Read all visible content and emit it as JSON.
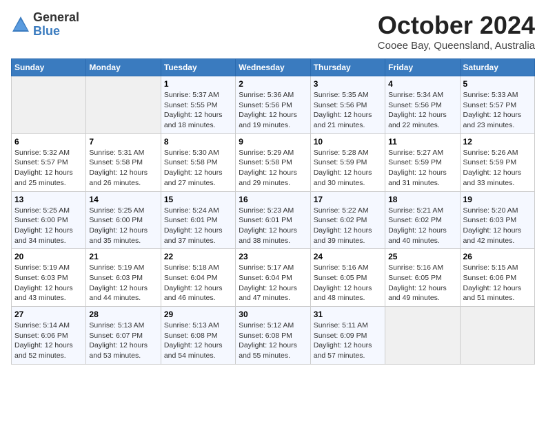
{
  "header": {
    "logo_line1": "General",
    "logo_line2": "Blue",
    "month": "October 2024",
    "location": "Cooee Bay, Queensland, Australia"
  },
  "weekdays": [
    "Sunday",
    "Monday",
    "Tuesday",
    "Wednesday",
    "Thursday",
    "Friday",
    "Saturday"
  ],
  "weeks": [
    [
      {
        "day": "",
        "sunrise": "",
        "sunset": "",
        "daylight": ""
      },
      {
        "day": "",
        "sunrise": "",
        "sunset": "",
        "daylight": ""
      },
      {
        "day": "1",
        "sunrise": "Sunrise: 5:37 AM",
        "sunset": "Sunset: 5:55 PM",
        "daylight": "Daylight: 12 hours and 18 minutes."
      },
      {
        "day": "2",
        "sunrise": "Sunrise: 5:36 AM",
        "sunset": "Sunset: 5:56 PM",
        "daylight": "Daylight: 12 hours and 19 minutes."
      },
      {
        "day": "3",
        "sunrise": "Sunrise: 5:35 AM",
        "sunset": "Sunset: 5:56 PM",
        "daylight": "Daylight: 12 hours and 21 minutes."
      },
      {
        "day": "4",
        "sunrise": "Sunrise: 5:34 AM",
        "sunset": "Sunset: 5:56 PM",
        "daylight": "Daylight: 12 hours and 22 minutes."
      },
      {
        "day": "5",
        "sunrise": "Sunrise: 5:33 AM",
        "sunset": "Sunset: 5:57 PM",
        "daylight": "Daylight: 12 hours and 23 minutes."
      }
    ],
    [
      {
        "day": "6",
        "sunrise": "Sunrise: 5:32 AM",
        "sunset": "Sunset: 5:57 PM",
        "daylight": "Daylight: 12 hours and 25 minutes."
      },
      {
        "day": "7",
        "sunrise": "Sunrise: 5:31 AM",
        "sunset": "Sunset: 5:58 PM",
        "daylight": "Daylight: 12 hours and 26 minutes."
      },
      {
        "day": "8",
        "sunrise": "Sunrise: 5:30 AM",
        "sunset": "Sunset: 5:58 PM",
        "daylight": "Daylight: 12 hours and 27 minutes."
      },
      {
        "day": "9",
        "sunrise": "Sunrise: 5:29 AM",
        "sunset": "Sunset: 5:58 PM",
        "daylight": "Daylight: 12 hours and 29 minutes."
      },
      {
        "day": "10",
        "sunrise": "Sunrise: 5:28 AM",
        "sunset": "Sunset: 5:59 PM",
        "daylight": "Daylight: 12 hours and 30 minutes."
      },
      {
        "day": "11",
        "sunrise": "Sunrise: 5:27 AM",
        "sunset": "Sunset: 5:59 PM",
        "daylight": "Daylight: 12 hours and 31 minutes."
      },
      {
        "day": "12",
        "sunrise": "Sunrise: 5:26 AM",
        "sunset": "Sunset: 5:59 PM",
        "daylight": "Daylight: 12 hours and 33 minutes."
      }
    ],
    [
      {
        "day": "13",
        "sunrise": "Sunrise: 5:25 AM",
        "sunset": "Sunset: 6:00 PM",
        "daylight": "Daylight: 12 hours and 34 minutes."
      },
      {
        "day": "14",
        "sunrise": "Sunrise: 5:25 AM",
        "sunset": "Sunset: 6:00 PM",
        "daylight": "Daylight: 12 hours and 35 minutes."
      },
      {
        "day": "15",
        "sunrise": "Sunrise: 5:24 AM",
        "sunset": "Sunset: 6:01 PM",
        "daylight": "Daylight: 12 hours and 37 minutes."
      },
      {
        "day": "16",
        "sunrise": "Sunrise: 5:23 AM",
        "sunset": "Sunset: 6:01 PM",
        "daylight": "Daylight: 12 hours and 38 minutes."
      },
      {
        "day": "17",
        "sunrise": "Sunrise: 5:22 AM",
        "sunset": "Sunset: 6:02 PM",
        "daylight": "Daylight: 12 hours and 39 minutes."
      },
      {
        "day": "18",
        "sunrise": "Sunrise: 5:21 AM",
        "sunset": "Sunset: 6:02 PM",
        "daylight": "Daylight: 12 hours and 40 minutes."
      },
      {
        "day": "19",
        "sunrise": "Sunrise: 5:20 AM",
        "sunset": "Sunset: 6:03 PM",
        "daylight": "Daylight: 12 hours and 42 minutes."
      }
    ],
    [
      {
        "day": "20",
        "sunrise": "Sunrise: 5:19 AM",
        "sunset": "Sunset: 6:03 PM",
        "daylight": "Daylight: 12 hours and 43 minutes."
      },
      {
        "day": "21",
        "sunrise": "Sunrise: 5:19 AM",
        "sunset": "Sunset: 6:03 PM",
        "daylight": "Daylight: 12 hours and 44 minutes."
      },
      {
        "day": "22",
        "sunrise": "Sunrise: 5:18 AM",
        "sunset": "Sunset: 6:04 PM",
        "daylight": "Daylight: 12 hours and 46 minutes."
      },
      {
        "day": "23",
        "sunrise": "Sunrise: 5:17 AM",
        "sunset": "Sunset: 6:04 PM",
        "daylight": "Daylight: 12 hours and 47 minutes."
      },
      {
        "day": "24",
        "sunrise": "Sunrise: 5:16 AM",
        "sunset": "Sunset: 6:05 PM",
        "daylight": "Daylight: 12 hours and 48 minutes."
      },
      {
        "day": "25",
        "sunrise": "Sunrise: 5:16 AM",
        "sunset": "Sunset: 6:05 PM",
        "daylight": "Daylight: 12 hours and 49 minutes."
      },
      {
        "day": "26",
        "sunrise": "Sunrise: 5:15 AM",
        "sunset": "Sunset: 6:06 PM",
        "daylight": "Daylight: 12 hours and 51 minutes."
      }
    ],
    [
      {
        "day": "27",
        "sunrise": "Sunrise: 5:14 AM",
        "sunset": "Sunset: 6:06 PM",
        "daylight": "Daylight: 12 hours and 52 minutes."
      },
      {
        "day": "28",
        "sunrise": "Sunrise: 5:13 AM",
        "sunset": "Sunset: 6:07 PM",
        "daylight": "Daylight: 12 hours and 53 minutes."
      },
      {
        "day": "29",
        "sunrise": "Sunrise: 5:13 AM",
        "sunset": "Sunset: 6:08 PM",
        "daylight": "Daylight: 12 hours and 54 minutes."
      },
      {
        "day": "30",
        "sunrise": "Sunrise: 5:12 AM",
        "sunset": "Sunset: 6:08 PM",
        "daylight": "Daylight: 12 hours and 55 minutes."
      },
      {
        "day": "31",
        "sunrise": "Sunrise: 5:11 AM",
        "sunset": "Sunset: 6:09 PM",
        "daylight": "Daylight: 12 hours and 57 minutes."
      },
      {
        "day": "",
        "sunrise": "",
        "sunset": "",
        "daylight": ""
      },
      {
        "day": "",
        "sunrise": "",
        "sunset": "",
        "daylight": ""
      }
    ]
  ]
}
